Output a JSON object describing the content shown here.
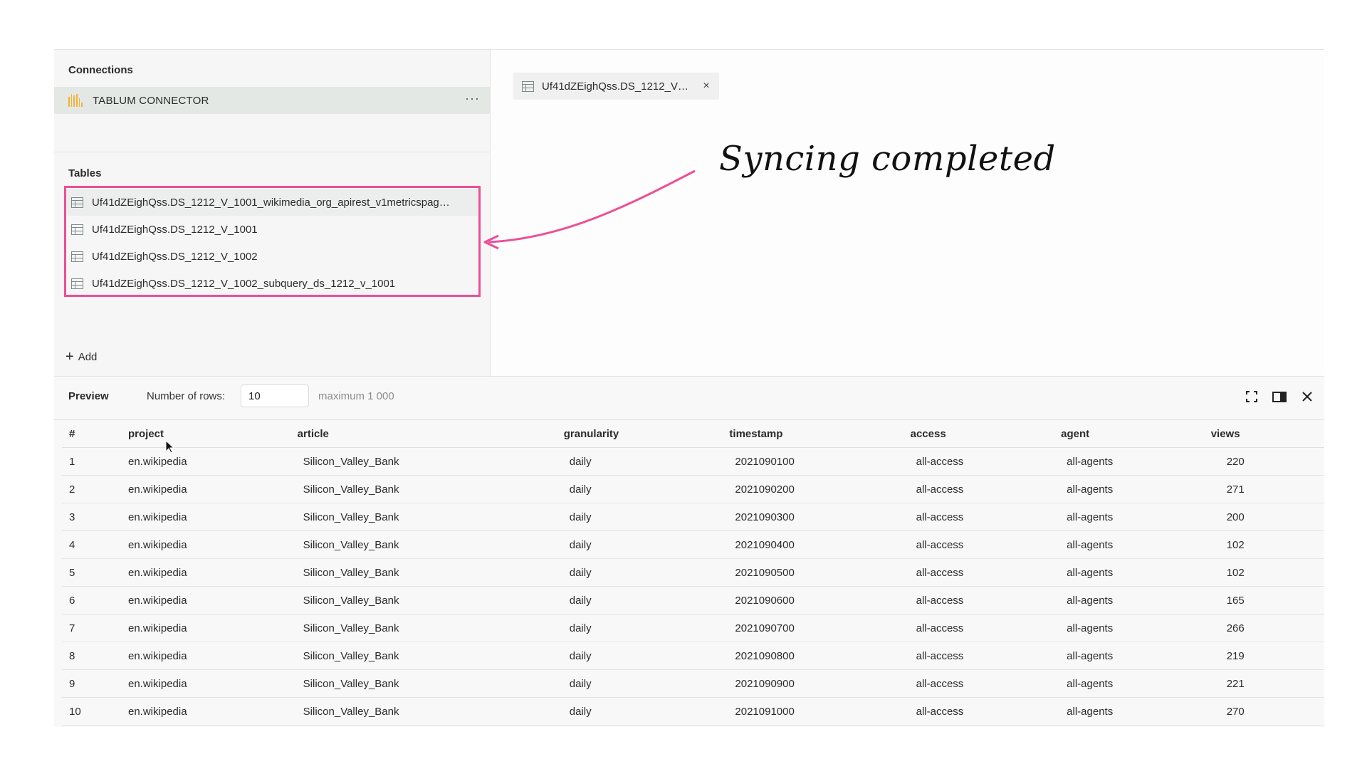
{
  "sidebar": {
    "connections_title": "Connections",
    "connector": {
      "label": "TABLUM CONNECTOR",
      "icon": "connector-icon",
      "menu": "···"
    },
    "tables_title": "Tables",
    "tables": [
      {
        "label": "Uf41dZEighQss.DS_1212_V_1001_wikimedia_org_apirest_v1metricspag…",
        "icon": "table-icon"
      },
      {
        "label": "Uf41dZEighQss.DS_1212_V_1001",
        "icon": "table-icon"
      },
      {
        "label": "Uf41dZEighQss.DS_1212_V_1002",
        "icon": "table-icon"
      },
      {
        "label": "Uf41dZEighQss.DS_1212_V_1002_subquery_ds_1212_v_1001",
        "icon": "table-icon"
      }
    ],
    "add_label": "Add"
  },
  "editor": {
    "tab": {
      "label": "Uf41dZEighQss.DS_1212_V…",
      "icon": "table-icon",
      "close": "×"
    }
  },
  "annotation": {
    "text": "Syncing completed",
    "color": "#ec4f96"
  },
  "preview": {
    "title": "Preview",
    "rows_label": "Number of rows:",
    "rows_value": "10",
    "rows_max": "maximum 1 000",
    "tools": [
      "fullscreen-icon",
      "side-panel-icon",
      "close-icon"
    ],
    "columns": [
      "#",
      "project",
      "article",
      "granularity",
      "timestamp",
      "access",
      "agent",
      "views"
    ],
    "rows": [
      [
        "1",
        "en.wikipedia",
        "Silicon_Valley_Bank",
        "daily",
        "2021090100",
        "all-access",
        "all-agents",
        "220"
      ],
      [
        "2",
        "en.wikipedia",
        "Silicon_Valley_Bank",
        "daily",
        "2021090200",
        "all-access",
        "all-agents",
        "271"
      ],
      [
        "3",
        "en.wikipedia",
        "Silicon_Valley_Bank",
        "daily",
        "2021090300",
        "all-access",
        "all-agents",
        "200"
      ],
      [
        "4",
        "en.wikipedia",
        "Silicon_Valley_Bank",
        "daily",
        "2021090400",
        "all-access",
        "all-agents",
        "102"
      ],
      [
        "5",
        "en.wikipedia",
        "Silicon_Valley_Bank",
        "daily",
        "2021090500",
        "all-access",
        "all-agents",
        "102"
      ],
      [
        "6",
        "en.wikipedia",
        "Silicon_Valley_Bank",
        "daily",
        "2021090600",
        "all-access",
        "all-agents",
        "165"
      ],
      [
        "7",
        "en.wikipedia",
        "Silicon_Valley_Bank",
        "daily",
        "2021090700",
        "all-access",
        "all-agents",
        "266"
      ],
      [
        "8",
        "en.wikipedia",
        "Silicon_Valley_Bank",
        "daily",
        "2021090800",
        "all-access",
        "all-agents",
        "219"
      ],
      [
        "9",
        "en.wikipedia",
        "Silicon_Valley_Bank",
        "daily",
        "2021090900",
        "all-access",
        "all-agents",
        "221"
      ],
      [
        "10",
        "en.wikipedia",
        "Silicon_Valley_Bank",
        "daily",
        "2021091000",
        "all-access",
        "all-agents",
        "270"
      ]
    ]
  },
  "colors": {
    "accent": "#ec4f96",
    "connector": "#f2b233",
    "selected_row": "#e3e8e5"
  }
}
